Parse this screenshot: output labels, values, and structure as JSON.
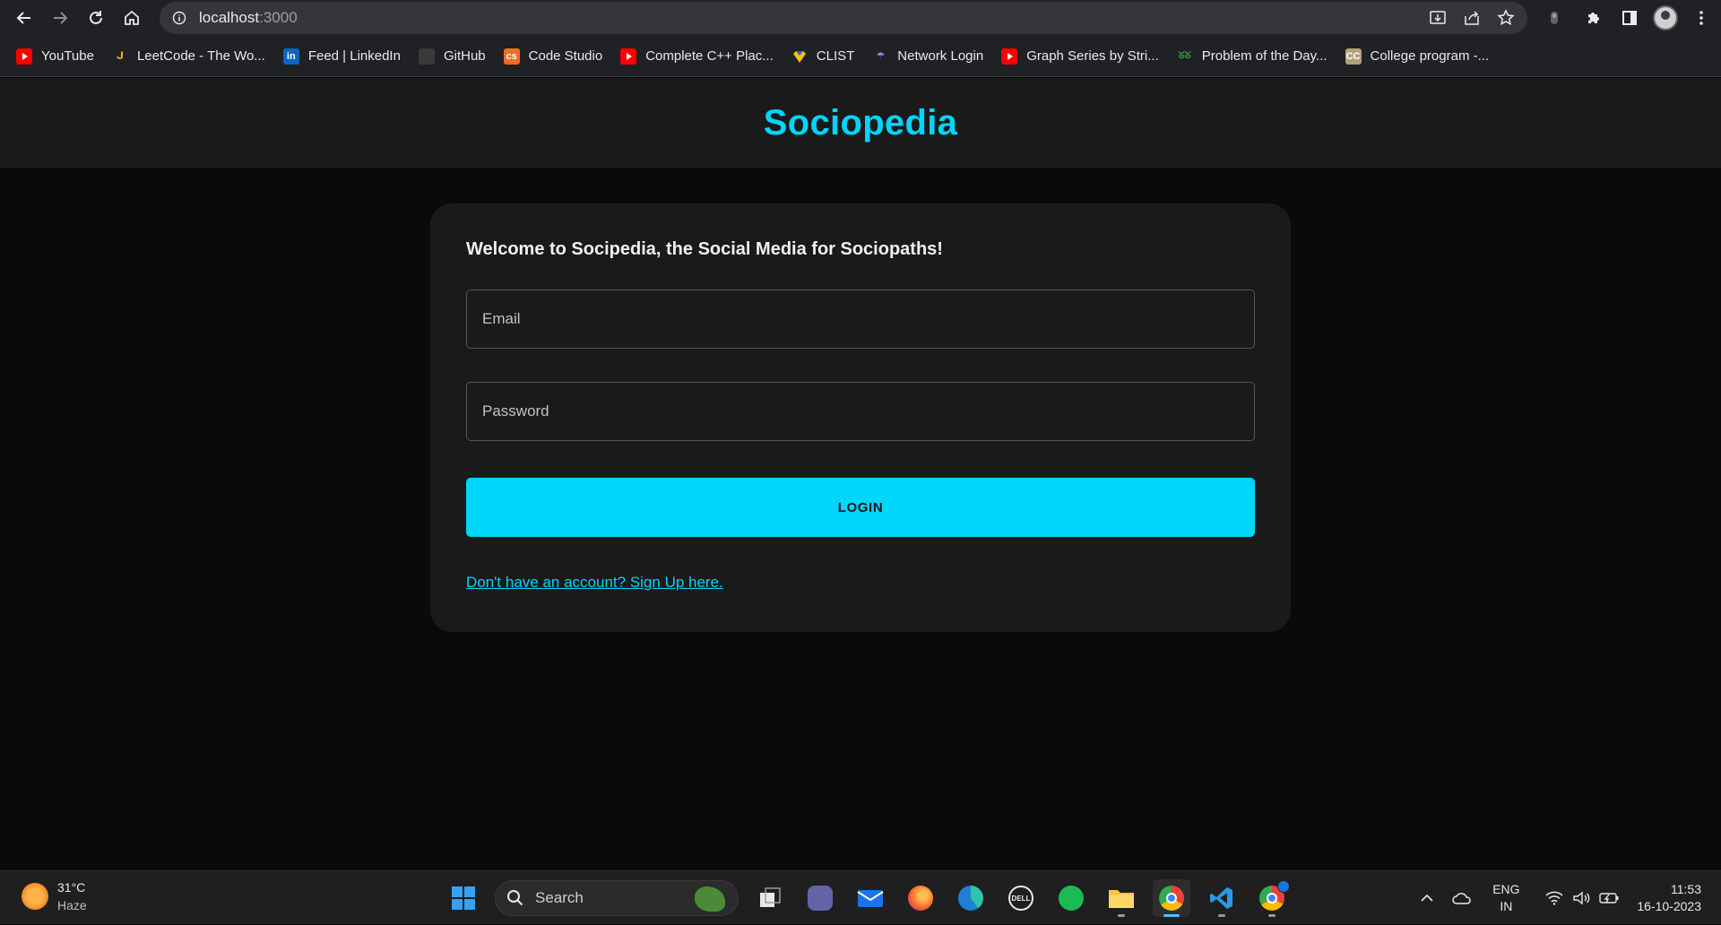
{
  "browser": {
    "url_host": "localhost",
    "url_port": ":3000",
    "bookmarks": [
      {
        "label": "YouTube",
        "icon": "youtube-icon"
      },
      {
        "label": "LeetCode - The Wo...",
        "icon": "leetcode-icon"
      },
      {
        "label": "Feed | LinkedIn",
        "icon": "linkedin-icon"
      },
      {
        "label": "GitHub",
        "icon": "github-icon"
      },
      {
        "label": "Code Studio",
        "icon": "codestudio-icon"
      },
      {
        "label": "Complete C++ Plac...",
        "icon": "youtube-icon"
      },
      {
        "label": "CLIST",
        "icon": "clist-icon"
      },
      {
        "label": "Network Login",
        "icon": "umbrella-icon"
      },
      {
        "label": "Graph Series by Stri...",
        "icon": "youtube-icon"
      },
      {
        "label": "Problem of the Day...",
        "icon": "gfg-icon"
      },
      {
        "label": "College program -...",
        "icon": "cc-icon"
      }
    ]
  },
  "app": {
    "brand": "Sociopedia",
    "welcome": "Welcome to Socipedia, the Social Media for Sociopaths!",
    "email_placeholder": "Email",
    "password_placeholder": "Password",
    "login_label": "LOGIN",
    "signup_link": "Don't have an account? Sign Up here."
  },
  "taskbar": {
    "temperature": "31°C",
    "weather": "Haze",
    "search_label": "Search",
    "lang_top": "ENG",
    "lang_bottom": "IN",
    "time": "11:53",
    "date": "16-10-2023"
  },
  "colors": {
    "accent": "#00d5fa",
    "card_bg": "#1a1a1a",
    "page_bg": "#0a0a0a"
  }
}
